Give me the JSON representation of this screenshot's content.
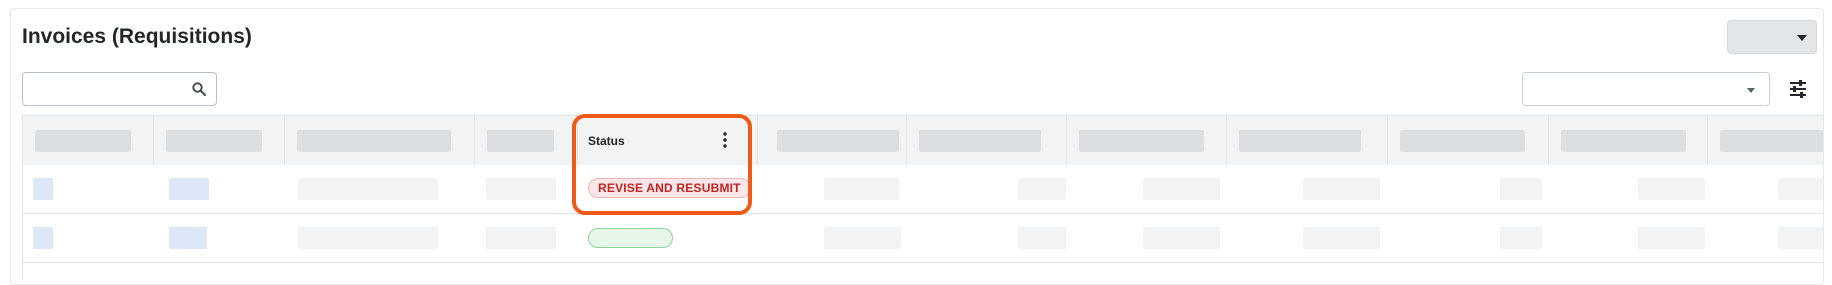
{
  "page": {
    "title": "Invoices (Requisitions)"
  },
  "toolbar": {
    "search": {
      "value": "",
      "placeholder": "",
      "icon": "search-icon"
    },
    "filter_select": {
      "value": "",
      "icon": "chevron-down-icon"
    },
    "filter_settings_icon": "tune-icon",
    "top_dropdown": {
      "label": "",
      "icon": "caret-down-icon"
    }
  },
  "table": {
    "columns": [
      {
        "key": "col1",
        "label": ""
      },
      {
        "key": "col2",
        "label": ""
      },
      {
        "key": "col3",
        "label": ""
      },
      {
        "key": "col4",
        "label": ""
      },
      {
        "key": "status",
        "label": "Status"
      },
      {
        "key": "col6",
        "label": ""
      },
      {
        "key": "col7",
        "label": ""
      },
      {
        "key": "col8",
        "label": ""
      },
      {
        "key": "col9",
        "label": ""
      },
      {
        "key": "col10",
        "label": ""
      },
      {
        "key": "col11",
        "label": ""
      },
      {
        "key": "col12",
        "label": ""
      }
    ],
    "rows": [
      {
        "status": "REVISE AND RESUBMIT",
        "status_color": "#c42323"
      },
      {
        "status": "",
        "status_color": "#2e9e4a"
      }
    ],
    "status_menu_icon": "kebab-menu-icon"
  },
  "highlight": {
    "target": "status-column",
    "color": "#f05a19"
  }
}
